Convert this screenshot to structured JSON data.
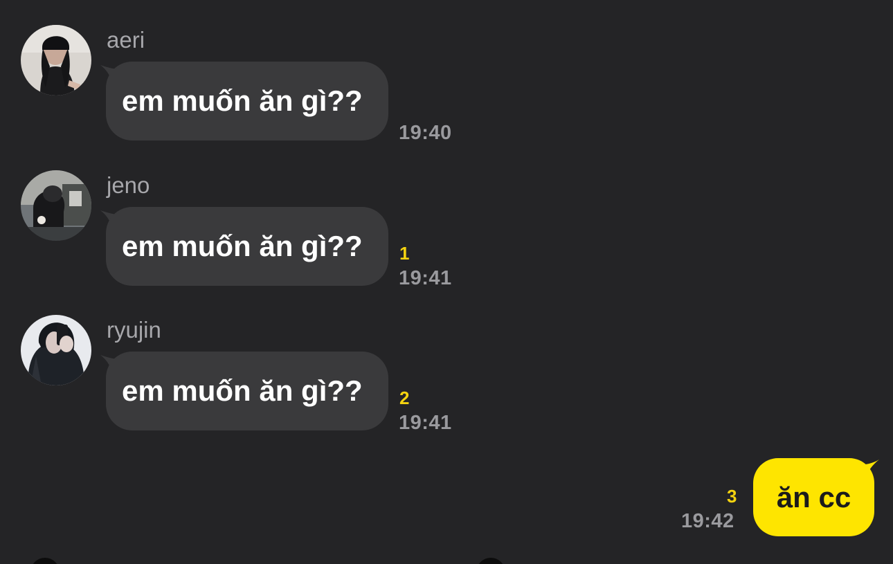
{
  "messages": [
    {
      "sender": "aeri",
      "avatar_icon": "avatar-aeri-photo",
      "text": "em muốn ăn gì??",
      "unread": "",
      "time": "19:40"
    },
    {
      "sender": "jeno",
      "avatar_icon": "avatar-jeno-photo",
      "text": "em muốn ăn gì??",
      "unread": "1",
      "time": "19:41"
    },
    {
      "sender": "ryujin",
      "avatar_icon": "avatar-ryujin-photo",
      "text": "em muốn ăn gì??",
      "unread": "2",
      "time": "19:41"
    }
  ],
  "my_message": {
    "text": "ăn cc",
    "unread": "3",
    "time": "19:42"
  },
  "colors": {
    "background": "#242426",
    "incoming_bubble": "#3a3a3c",
    "outgoing_bubble": "#fee500",
    "unread_count": "#f4d310",
    "timestamp": "#9a9a9e",
    "sender_name": "#a7a7ab"
  }
}
